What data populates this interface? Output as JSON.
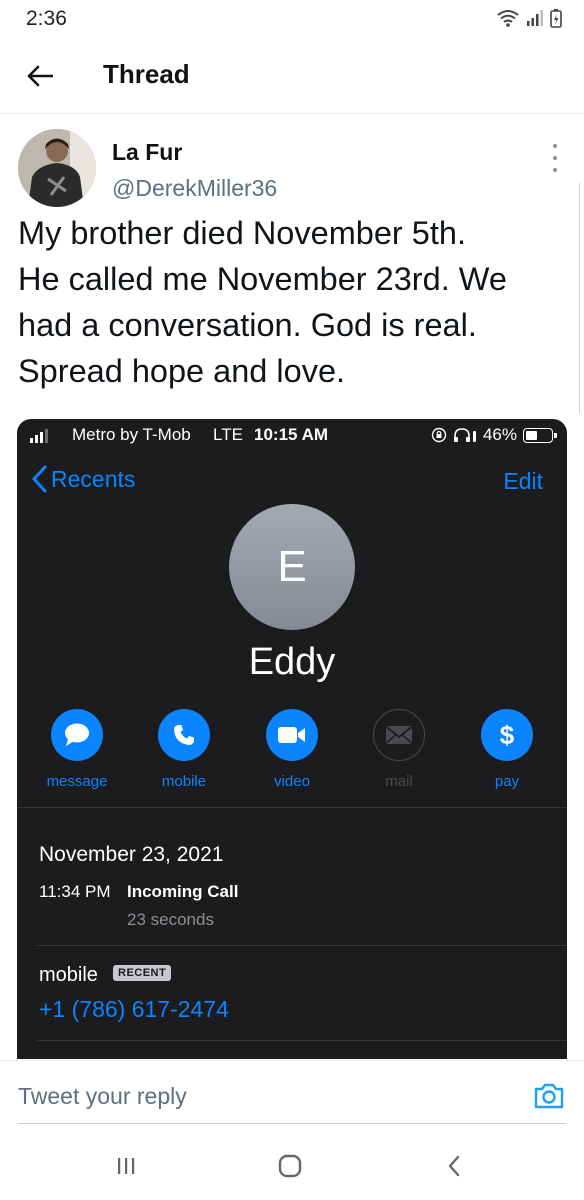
{
  "status_bar": {
    "time": "2:36"
  },
  "header": {
    "title": "Thread"
  },
  "tweet": {
    "display_name": "La Fur",
    "handle": "@DerekMiller36",
    "text_lines": [
      "My brother died November 5th.",
      "He called me November 23rd. We",
      "had a conversation. God is real.",
      "Spread hope and love."
    ]
  },
  "embed": {
    "status": {
      "carrier": "Metro by T-Mob",
      "network": "LTE",
      "time": "10:15 AM",
      "battery": "46%",
      "battery_level": 0.46
    },
    "nav": {
      "back_label": "Recents",
      "edit_label": "Edit"
    },
    "contact": {
      "initial": "E",
      "name": "Eddy"
    },
    "actions": [
      {
        "label": "message",
        "icon": "message-icon",
        "enabled": true
      },
      {
        "label": "mobile",
        "icon": "phone-icon",
        "enabled": true
      },
      {
        "label": "video",
        "icon": "video-icon",
        "enabled": true
      },
      {
        "label": "mail",
        "icon": "mail-icon",
        "enabled": false
      },
      {
        "label": "pay",
        "icon": "dollar-icon",
        "enabled": true
      }
    ],
    "call_log": {
      "date": "November 23, 2021",
      "time": "11:34 PM",
      "type": "Incoming Call",
      "duration": "23 seconds"
    },
    "phone": {
      "label": "mobile",
      "badge": "RECENT",
      "number": "+1 (786) 617-2474"
    },
    "colors": {
      "accent": "#0a84ff",
      "background": "#1c1c1e"
    }
  },
  "reply": {
    "placeholder": "Tweet your reply"
  },
  "colors": {
    "twitter_blue": "#1da1f2",
    "secondary_text": "#5b7083"
  }
}
